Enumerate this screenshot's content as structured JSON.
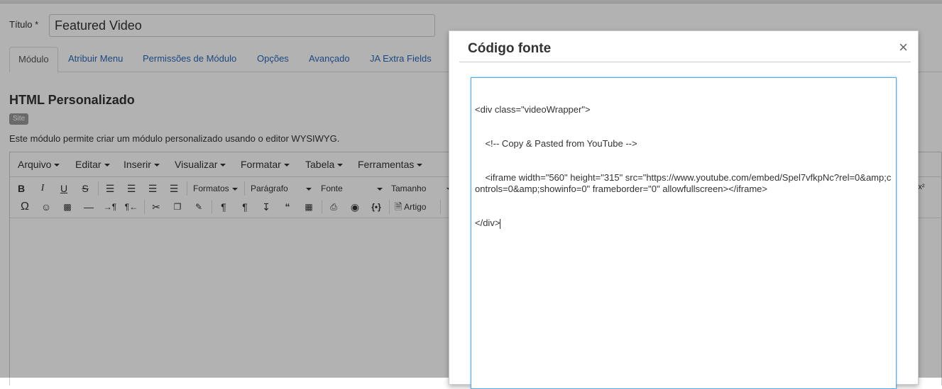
{
  "form": {
    "title_label": "Título *",
    "title_value": "Featured Video"
  },
  "tabs": [
    {
      "label": "Módulo",
      "active": true
    },
    {
      "label": "Atribuir Menu"
    },
    {
      "label": "Permissões de Módulo"
    },
    {
      "label": "Opções"
    },
    {
      "label": "Avançado"
    },
    {
      "label": "JA Extra Fields"
    }
  ],
  "module": {
    "heading": "HTML Personalizado",
    "badge": "Site",
    "description": "Este módulo permite criar um módulo personalizado usando o editor WYSIWYG."
  },
  "editor": {
    "menus": [
      "Arquivo",
      "Editar",
      "Inserir",
      "Visualizar",
      "Formatar",
      "Tabela",
      "Ferramentas"
    ],
    "toolbar": {
      "formats_label": "Formatos",
      "block_format": "Parágrafo",
      "font_family": "Fonte",
      "font_size": "Tamanho",
      "article_button": "Artigo"
    }
  },
  "modal": {
    "title": "Código fonte",
    "close_symbol": "×",
    "code_lines": [
      "<div class=\"videoWrapper\">",
      "    <!-- Copy & Pasted from YouTube -->",
      "    <iframe width=\"560\" height=\"315\" src=\"https://www.youtube.com/embed/Spel7vfkpNc?rel=0&amp;controls=0&amp;showinfo=0\" frameborder=\"0\" allowfullscreen></iframe>",
      "</div>"
    ]
  },
  "colors": {
    "link": "#2a69b8",
    "focus_border": "#58a9e0",
    "badge_bg": "#999999"
  },
  "icons": [
    "bold-icon",
    "italic-icon",
    "underline-icon",
    "strikethrough-icon",
    "align-left-icon",
    "align-center-icon",
    "align-right-icon",
    "align-justify-icon",
    "omega-icon",
    "emoticon-icon",
    "media-icon",
    "horizontal-rule-icon",
    "ltr-icon",
    "rtl-icon",
    "cut-icon",
    "copy-icon",
    "paste-icon",
    "pilcrow-icon",
    "visualblocks-icon",
    "insert-icon",
    "blockquote-icon",
    "template-icon",
    "print-icon",
    "preview-icon",
    "code-icon",
    "article-icon",
    "close-icon"
  ]
}
